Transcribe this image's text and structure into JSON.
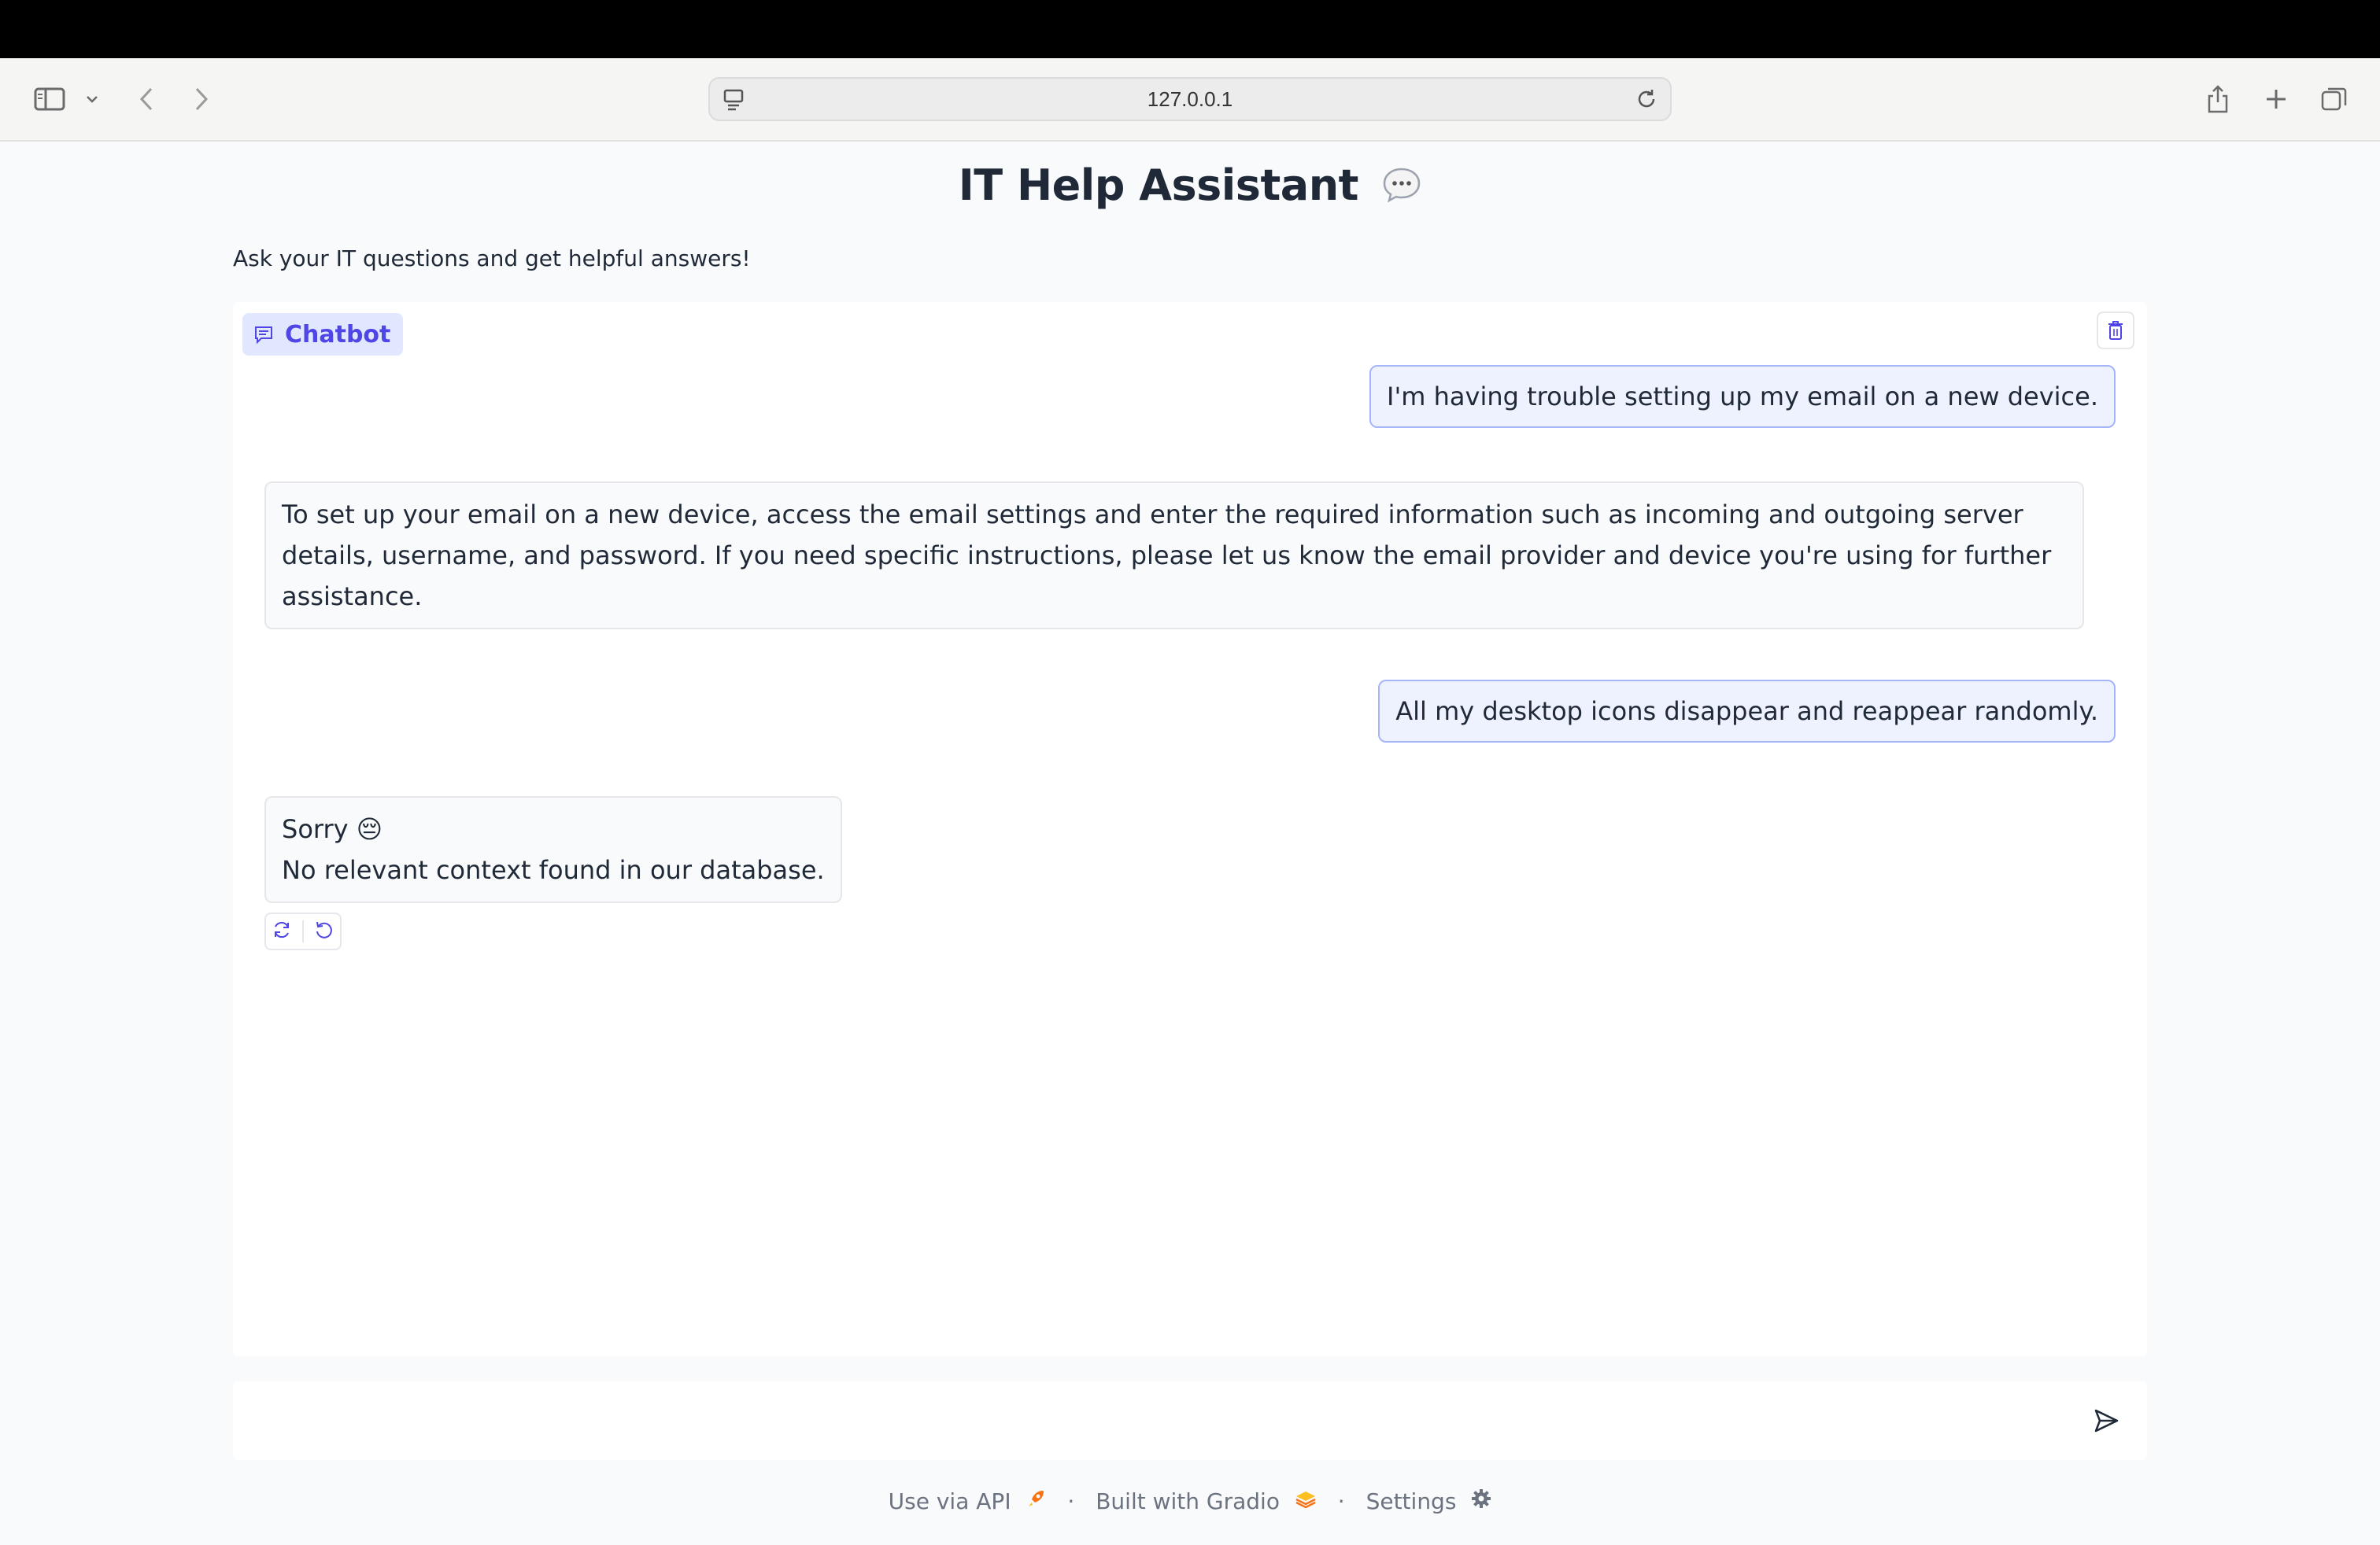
{
  "browser": {
    "url": "127.0.0.1"
  },
  "page": {
    "title": "IT Help Assistant",
    "subtitle": "Ask your IT questions and get helpful answers!"
  },
  "chatbot": {
    "label": "Chatbot",
    "messages": [
      {
        "role": "user",
        "text": "I'm having trouble setting up my email on a new device."
      },
      {
        "role": "bot",
        "text": "To set up your email on a new device, access the email settings and enter the required information such as incoming and outgoing server details, username, and password. If you need specific instructions, please let us know the email provider and device you're using for further assistance."
      },
      {
        "role": "user",
        "text": "All my desktop icons disappear and reappear randomly."
      },
      {
        "role": "bot",
        "line1": "Sorry 😔",
        "line2": "No relevant context found in our database."
      }
    ]
  },
  "input": {
    "value": "",
    "placeholder": ""
  },
  "footer": {
    "api": "Use via API",
    "built": "Built with Gradio",
    "settings": "Settings",
    "separator": "·"
  },
  "colors": {
    "accent": "#4f46e5",
    "user_bubble": "#eef2ff",
    "bot_bubble": "#f9fafb"
  }
}
